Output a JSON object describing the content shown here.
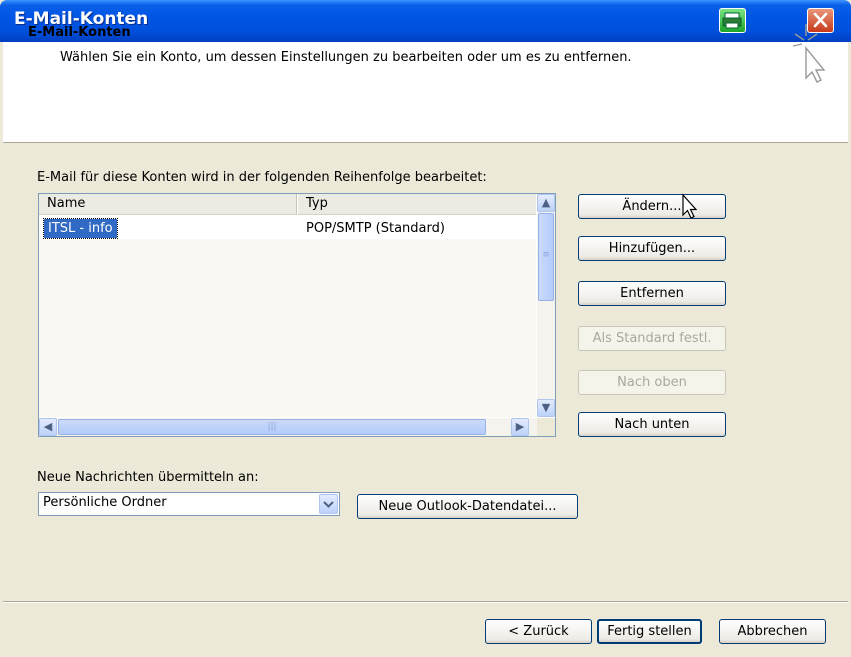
{
  "window": {
    "title": "E-Mail-Konten"
  },
  "header": {
    "title": "E-Mail-Konten",
    "subtitle": "Wählen Sie ein Konto, um dessen Einstellungen zu bearbeiten oder um es zu entfernen.",
    "icon": "wizard-sparkle-cursor-icon"
  },
  "accounts": {
    "caption": "E-Mail für diese Konten wird in der folgenden Reihenfolge bearbeitet:",
    "columns": [
      "Name",
      "Typ"
    ],
    "rows": [
      {
        "name": "ITSL - info",
        "type": "POP/SMTP (Standard)"
      }
    ]
  },
  "buttons": {
    "change": "Ändern...",
    "add": "Hinzufügen...",
    "remove": "Entfernen",
    "set_default": "Als Standard festl.",
    "move_up": "Nach oben",
    "move_down": "Nach unten"
  },
  "delivery": {
    "label": "Neue Nachrichten übermitteln an:",
    "selected": "Persönliche Ordner",
    "new_data_file": "Neue Outlook-Datendatei..."
  },
  "footer": {
    "back": "< Zurück",
    "finish": "Fertig stellen",
    "cancel": "Abbrechen"
  },
  "colors": {
    "titlebar": "#0055E5",
    "selection": "#316AC5",
    "dialog_bg": "#ECE9D8"
  }
}
